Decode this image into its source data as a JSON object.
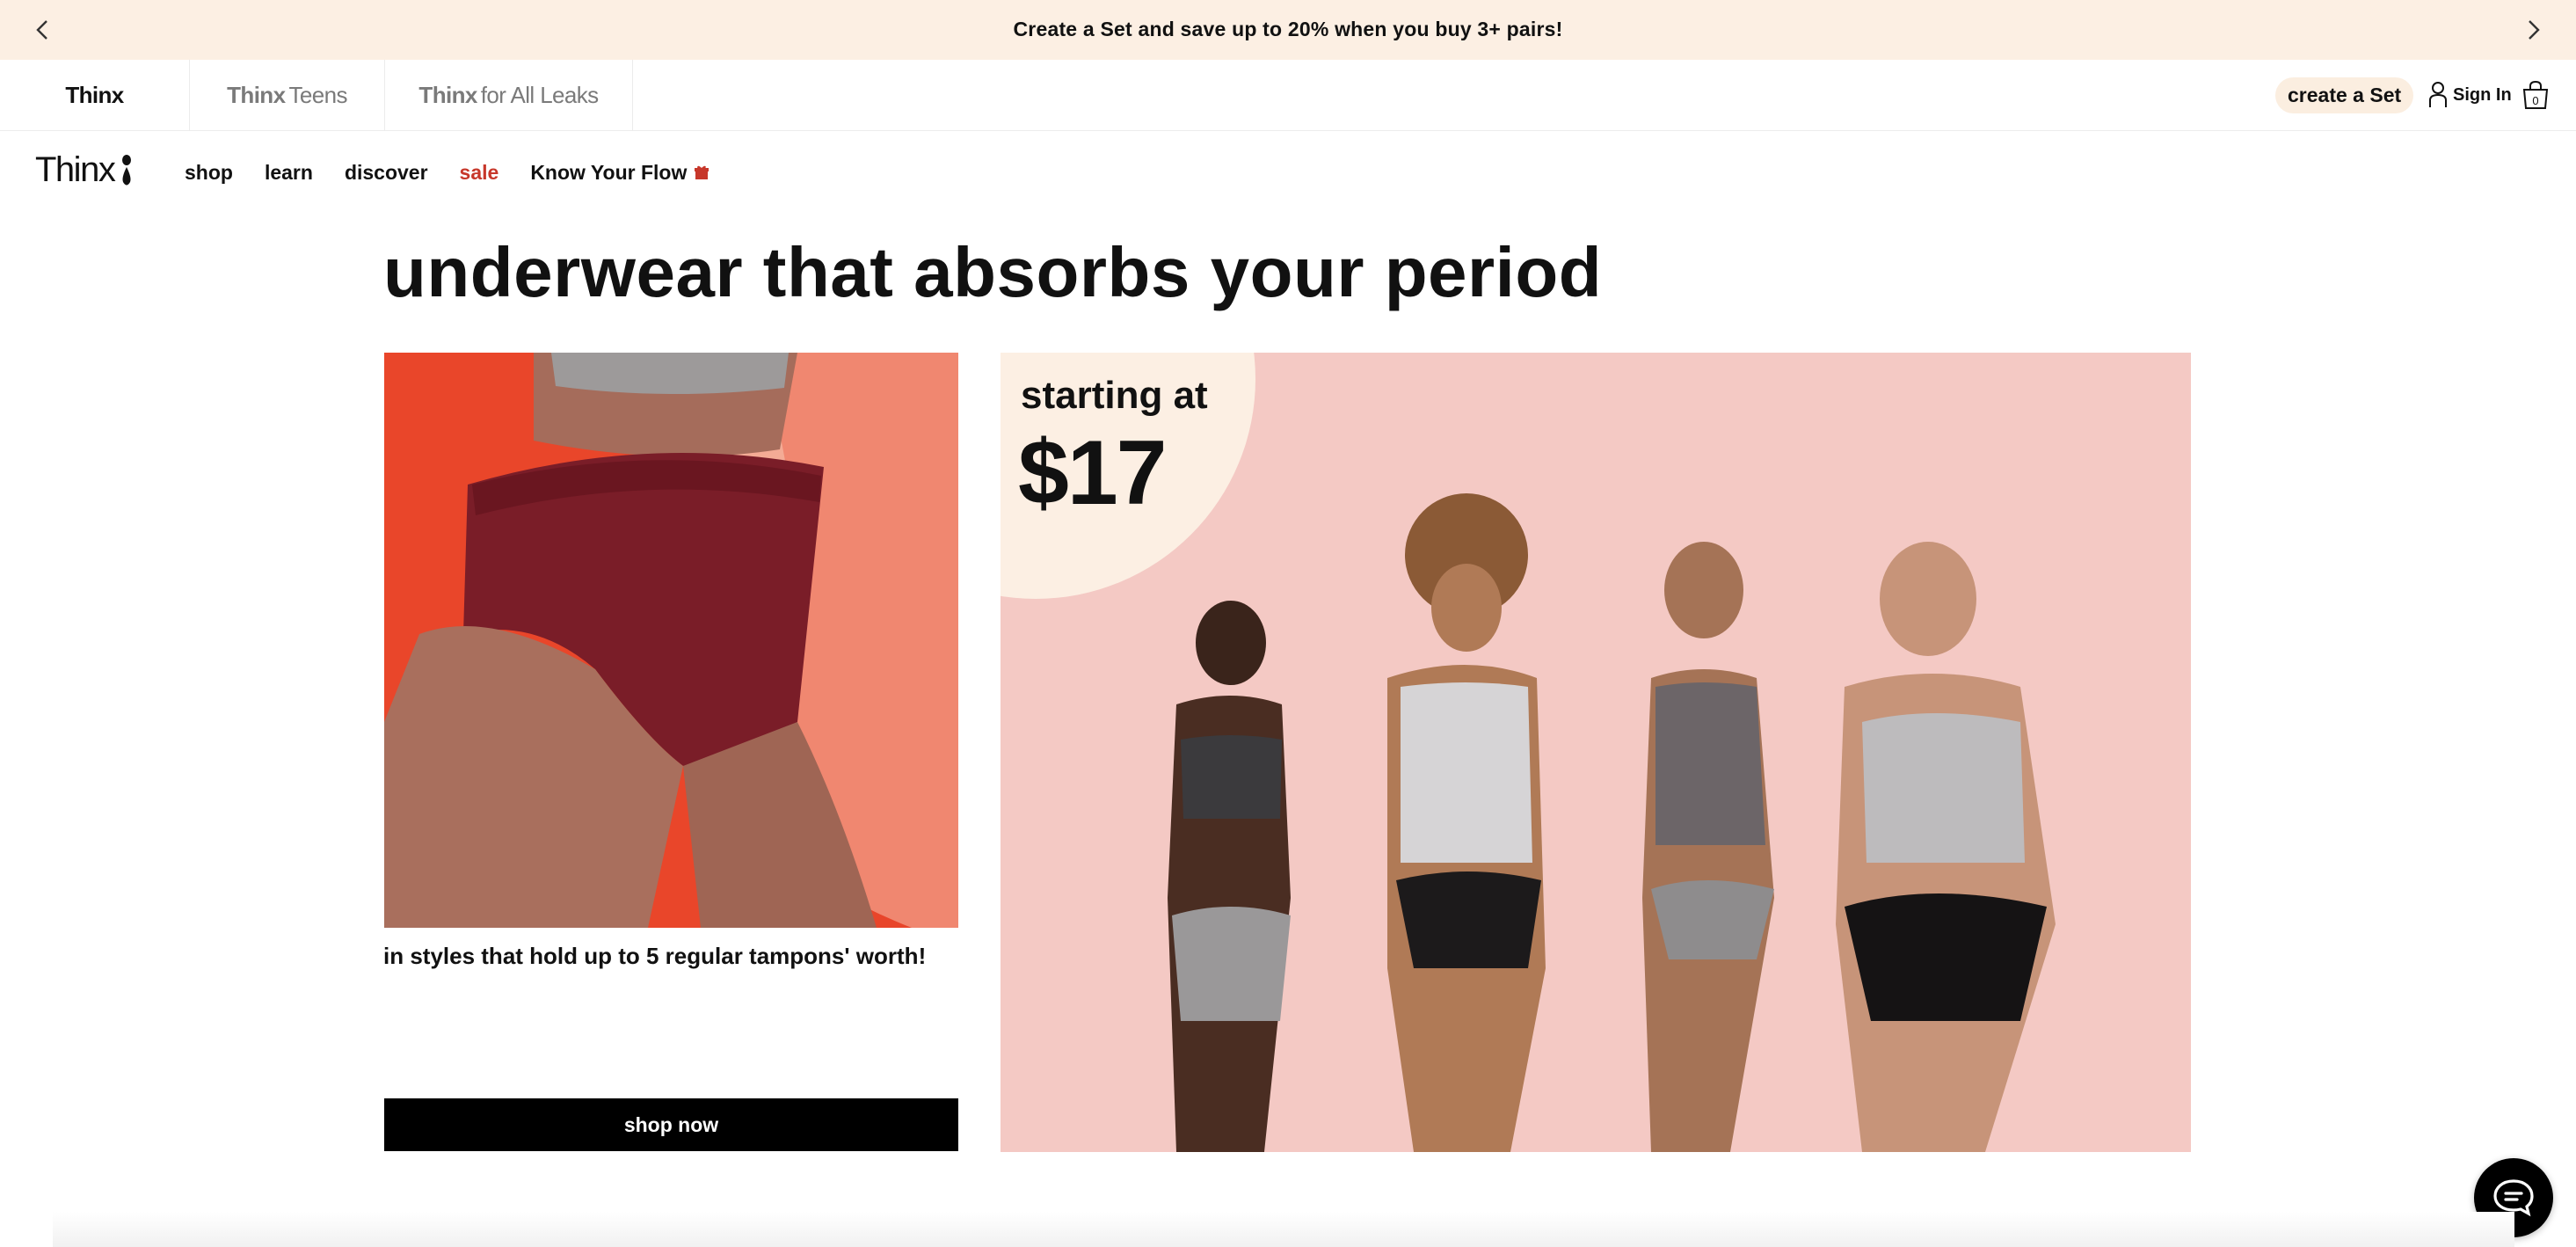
{
  "announcement": {
    "message": "Create a Set and save up to 20% when you buy 3+ pairs!"
  },
  "brand_tabs": [
    {
      "brand": "Thinx",
      "suffix": ""
    },
    {
      "brand": "Thinx",
      "suffix": "Teens"
    },
    {
      "brand": "Thinx",
      "suffix": "for All Leaks"
    }
  ],
  "utility": {
    "create_set": "create a Set",
    "sign_in": "Sign In",
    "cart_count": "0"
  },
  "logo": {
    "text": "Thinx"
  },
  "nav": {
    "items": [
      "shop",
      "learn",
      "discover",
      "sale",
      "Know Your Flow"
    ]
  },
  "hero": {
    "headline": "underwear that absorbs your period",
    "tagline": "in styles that hold up to 5 regular tampons' worth!",
    "cta": "shop now",
    "price_prefix": "starting at",
    "price": "$17"
  },
  "colors": {
    "announcement_bg": "#fcefe3",
    "sale": "#c7372a",
    "cta_bg": "#000000",
    "left_image_bg": "#e9462a",
    "right_image_bg": "#f4c9c4",
    "price_badge": "#fcefe3"
  }
}
